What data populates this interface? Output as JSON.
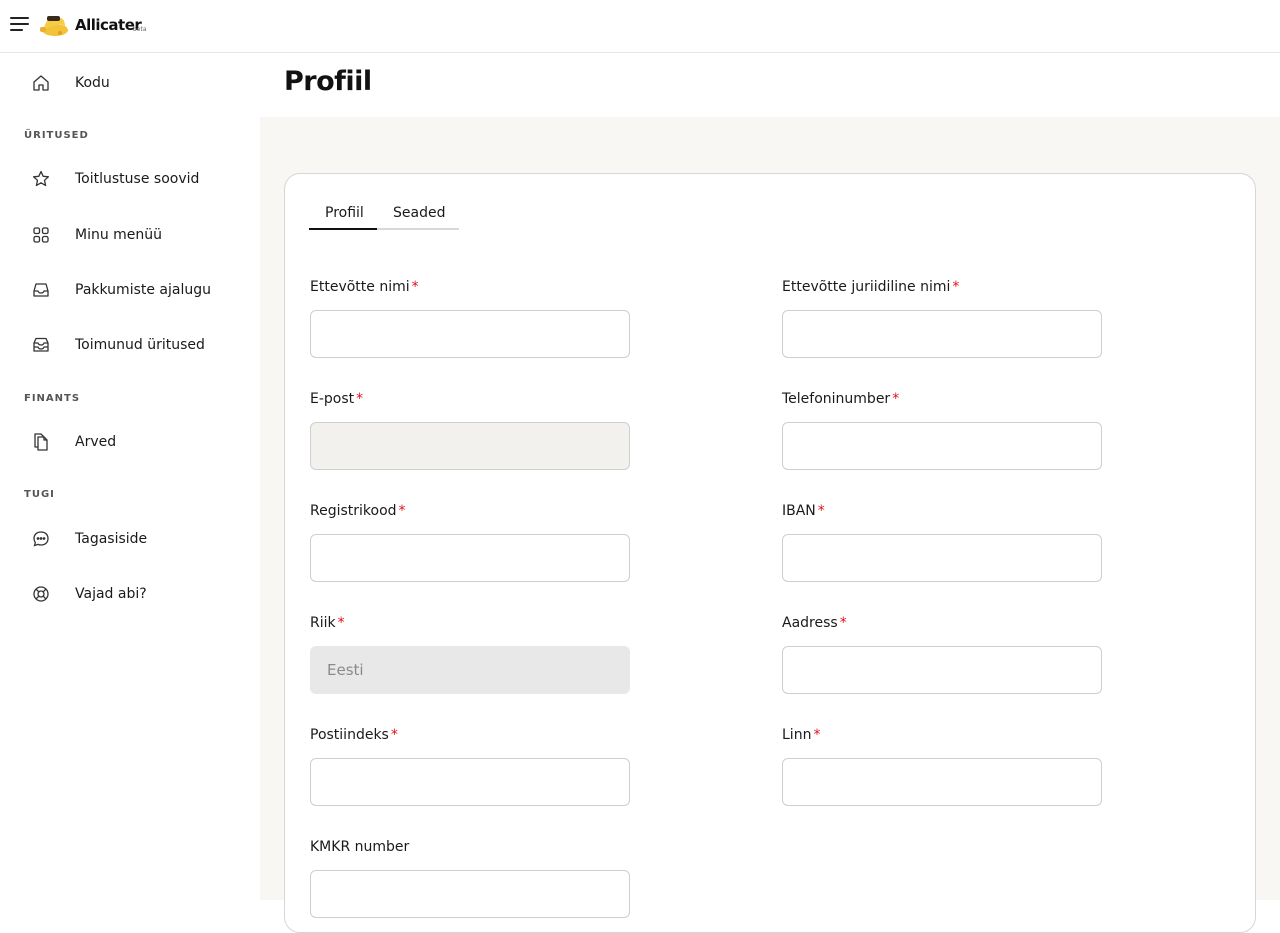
{
  "header": {
    "brand": "Allicater",
    "badge": "beta"
  },
  "sidebar": {
    "home": {
      "label": "Kodu",
      "icon": "home-icon"
    },
    "sections": [
      {
        "title": "ÜRITUSED"
      },
      {
        "title": "FINANTS"
      },
      {
        "title": "TUGI"
      }
    ],
    "items": [
      {
        "label": "Toitlustuse soovid",
        "icon": "star-icon"
      },
      {
        "label": "Minu menüü",
        "icon": "grid-icon"
      },
      {
        "label": "Pakkumiste ajalugu",
        "icon": "inbox-icon"
      },
      {
        "label": "Toimunud üritused",
        "icon": "archive-icon"
      },
      {
        "label": "Arved",
        "icon": "documents-icon"
      },
      {
        "label": "Tagasiside",
        "icon": "chat-bubble-icon"
      },
      {
        "label": "Vajad abi?",
        "icon": "lifebuoy-icon"
      }
    ]
  },
  "page": {
    "title": "Profiil"
  },
  "tabs": [
    {
      "label": "Profiil",
      "active": true
    },
    {
      "label": "Seaded",
      "active": false
    }
  ],
  "form": {
    "required_mark": "*",
    "company_name": {
      "label": "Ettevõtte nimi",
      "value": ""
    },
    "legal_name": {
      "label": "Ettevõtte juriidiline nimi",
      "value": ""
    },
    "email": {
      "label": "E-post",
      "value": ""
    },
    "phone": {
      "label": "Telefoninumber",
      "value": ""
    },
    "reg_code": {
      "label": "Registrikood",
      "value": ""
    },
    "iban": {
      "label": "IBAN",
      "value": ""
    },
    "country": {
      "label": "Riik",
      "value": "Eesti"
    },
    "address": {
      "label": "Aadress",
      "value": ""
    },
    "postal_code": {
      "label": "Postiindeks",
      "value": ""
    },
    "city": {
      "label": "Linn",
      "value": ""
    },
    "vat_number": {
      "label": "KMKR number",
      "value": ""
    }
  },
  "colors": {
    "required": "#e0101a",
    "content_bg": "#f8f7f4",
    "text": "#141414"
  }
}
